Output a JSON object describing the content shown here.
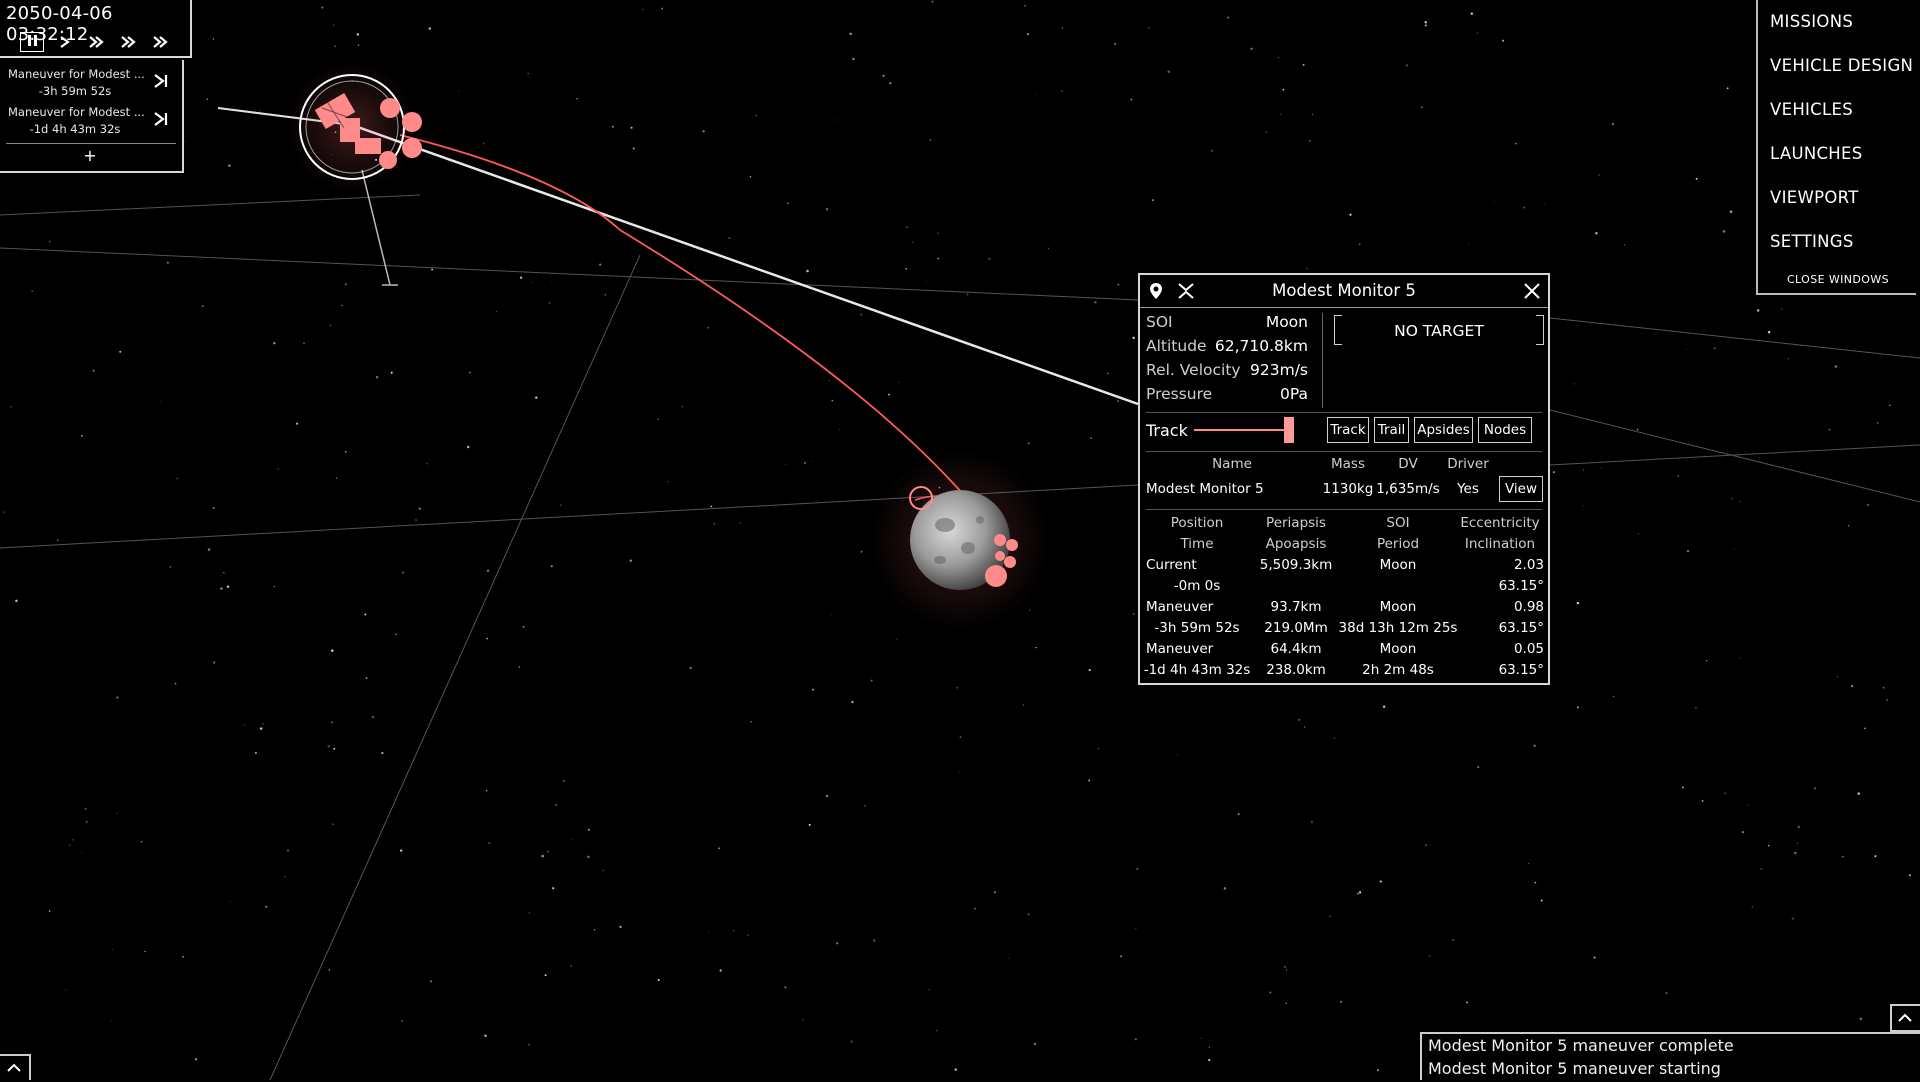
{
  "clock": {
    "datetime": "2050-04-06 03:32:12",
    "controls": [
      "pause-icon",
      "play-icon",
      "fast-forward-2-icon",
      "fast-forward-3-icon",
      "fast-forward-4-icon"
    ]
  },
  "maneuvers": {
    "items": [
      {
        "name": "Maneuver for Modest ...",
        "time": "-3h 59m 52s"
      },
      {
        "name": "Maneuver for Modest ...",
        "time": "-1d 4h 43m 32s"
      }
    ],
    "add_label": "+"
  },
  "menu": {
    "items": [
      "MISSIONS",
      "VEHICLE DESIGN",
      "VEHICLES",
      "LAUNCHES",
      "VIEWPORT",
      "SETTINGS"
    ],
    "close_windows": "CLOSE WINDOWS"
  },
  "vehicle_window": {
    "title": "Modest Monitor 5",
    "stats": [
      {
        "label": "SOI",
        "value": "Moon"
      },
      {
        "label": "Altitude",
        "value": "62,710.8km"
      },
      {
        "label": "Rel. Velocity",
        "value": "923m/s"
      },
      {
        "label": "Pressure",
        "value": "0Pa"
      }
    ],
    "target": "NO TARGET",
    "track": {
      "label": "Track",
      "buttons": [
        "Track",
        "Trail",
        "Apsides",
        "Nodes"
      ]
    },
    "parts": {
      "headers": [
        "Name",
        "Mass",
        "DV",
        "Driver"
      ],
      "row": {
        "name": "Modest Monitor 5",
        "mass": "1130kg",
        "dv": "1,635m/s",
        "driver": "Yes",
        "view": "View"
      }
    },
    "orbits": {
      "headers": [
        [
          "Position",
          "Periapsis",
          "SOI",
          "Eccentricity"
        ],
        [
          "Time",
          "Apoapsis",
          "Period",
          "Inclination"
        ]
      ],
      "rows": [
        {
          "kind": "Current",
          "time": "-0m 0s",
          "periapsis": "5,509.3km",
          "apoapsis": "",
          "soi": "Moon",
          "period": "",
          "eccentricity": "2.03",
          "inclination": "63.15°"
        },
        {
          "kind": "Maneuver",
          "time": "-3h 59m 52s",
          "periapsis": "93.7km",
          "apoapsis": "219.0Mm",
          "soi": "Moon",
          "period": "38d 13h 12m 25s",
          "eccentricity": "0.98",
          "inclination": "63.15°"
        },
        {
          "kind": "Maneuver",
          "time": "-1d 4h 43m 32s",
          "periapsis": "64.4km",
          "apoapsis": "238.0km",
          "soi": "Moon",
          "period": "2h 2m 48s",
          "eccentricity": "0.05",
          "inclination": "63.15°"
        }
      ]
    }
  },
  "notifications": [
    "Modest Monitor 5 maneuver complete",
    "Modest Monitor 5 maneuver starting"
  ],
  "colors": {
    "background": "#000000",
    "trajectory": "#ff5a5a",
    "vehicle_marker": "#ff8a8a",
    "ui_border": "#d8d8d8"
  }
}
